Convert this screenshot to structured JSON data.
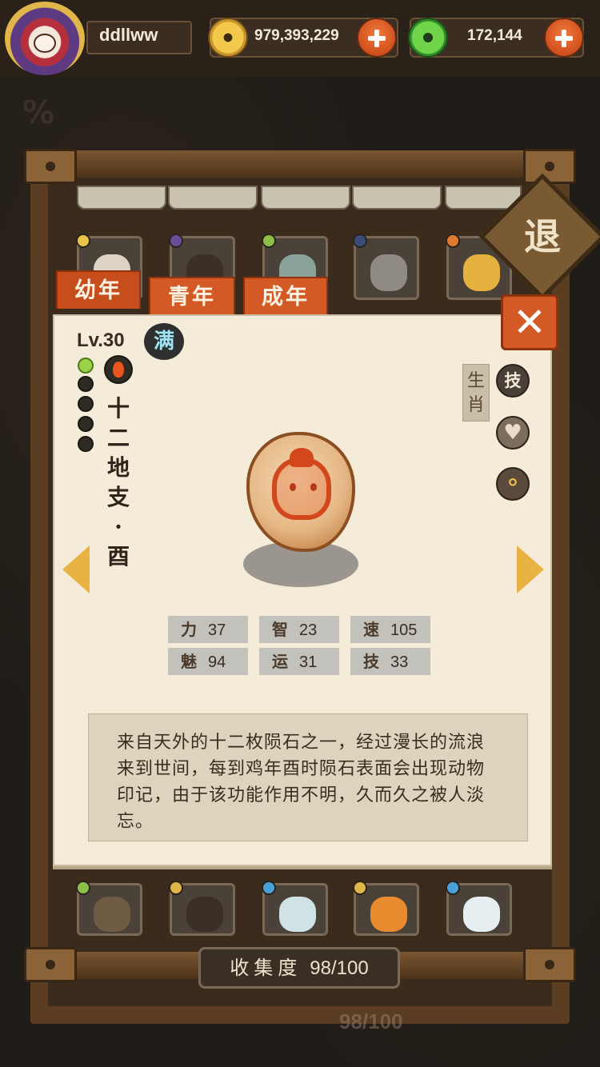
{
  "player": {
    "name": "ddllww"
  },
  "currency": {
    "coins": "979,393,229",
    "jade": "172,144"
  },
  "tabs": [
    "幼年",
    "青年",
    "成年"
  ],
  "exit_label": "退",
  "close_label": "✕",
  "creature": {
    "level": "Lv.30",
    "full_badge": "满",
    "name_chars": [
      "十",
      "二",
      "地",
      "支",
      "·",
      "酉"
    ],
    "category": "生肖",
    "skill_label": "技",
    "stats": [
      {
        "key": "力",
        "value": "37"
      },
      {
        "key": "智",
        "value": "23"
      },
      {
        "key": "速",
        "value": "105"
      },
      {
        "key": "魅",
        "value": "94"
      },
      {
        "key": "运",
        "value": "31"
      },
      {
        "key": "技",
        "value": "33"
      }
    ],
    "description": "来自天外的十二枚陨石之一，经过漫长的流浪来到世间，每到鸡年酉时陨石表面会出现动物印记，由于该功能作用不明，久而久之被人淡忘。"
  },
  "collection": {
    "label": "收集度",
    "value": "98/100",
    "ghost_value": "98/100"
  },
  "icons": {
    "avatar": "jester-avatar-icon",
    "coin": "gold-coin-icon",
    "jade": "green-jade-icon",
    "fire": "fire-element-icon",
    "heart": "heart-icon",
    "share": "share-icon"
  },
  "colors": {
    "accent_orange": "#d35a24",
    "paper": "#f4ecd9",
    "wood": "#5b3d22",
    "arrow_gold": "#e8b342",
    "grade_lit": "#9ad24a"
  }
}
